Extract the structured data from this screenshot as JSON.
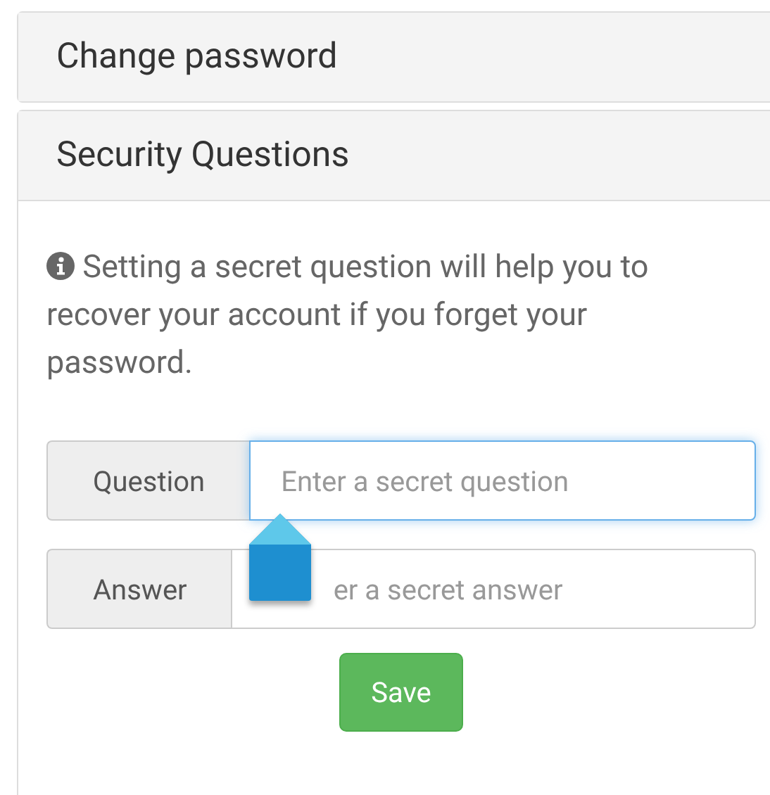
{
  "panels": [
    {
      "title": "Change password"
    },
    {
      "title": "Security Questions"
    }
  ],
  "info_text": "Setting a secret question will help you to recover your account if you forget your password.",
  "fields": [
    {
      "label": "Question",
      "placeholder": "Enter a secret question",
      "focused": true
    },
    {
      "label": "Answer",
      "placeholder": "er a secret answer",
      "focused": false
    }
  ],
  "save_button": "Save"
}
